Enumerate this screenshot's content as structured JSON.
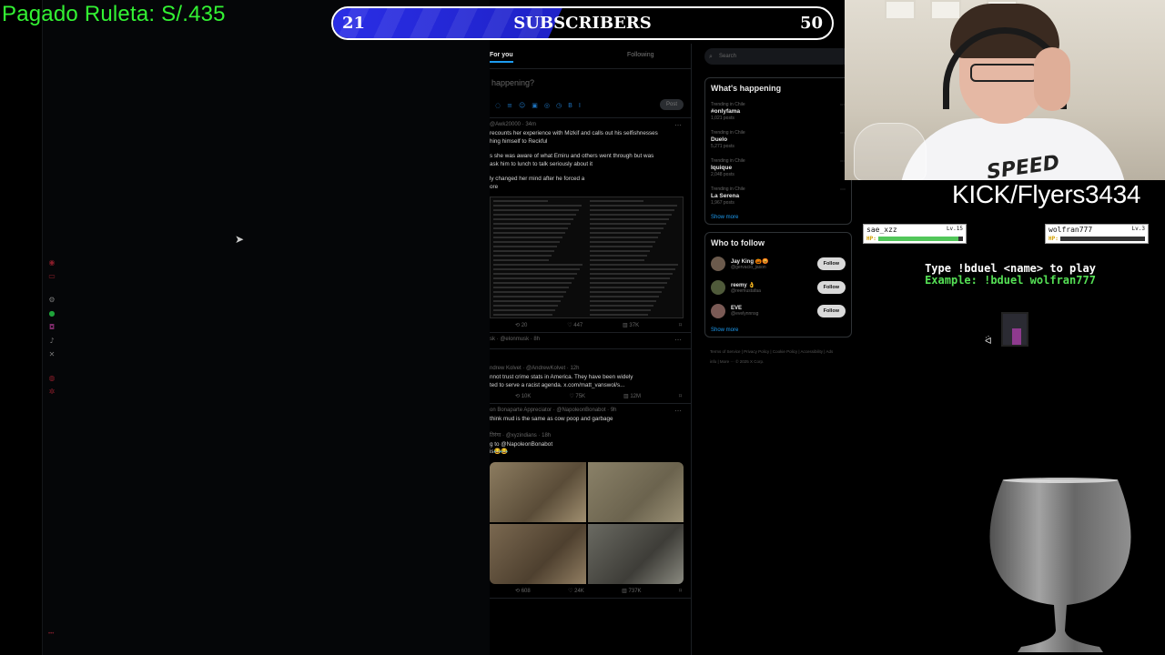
{
  "overlay": {
    "donation_text": "Pagado Ruleta: S/.435",
    "kick_handle": "KICK/Flyers3434"
  },
  "subscriber_goal": {
    "current": "21",
    "label": "SUBSCRIBERS",
    "goal": "50",
    "progress_fraction": 0.42,
    "fill_color": "#2a2ee6"
  },
  "feed": {
    "tabs": [
      {
        "label": "For you",
        "active": true
      },
      {
        "label": "Following",
        "active": false
      }
    ],
    "compose_placeholder": "happening?",
    "post_label": "Post",
    "tweets": [
      {
        "author": "@Awk20000 · 34m",
        "lines": [
          "recounts her experience with Mizkif and calls out his selfishnesses",
          "hing himself to Reckful",
          "",
          "s she was aware of what Emiru and others went through but was",
          "ask him to lunch to talk seriously about it",
          "",
          "ly changed her mind after he forced a",
          "ore"
        ],
        "stats": [
          "20",
          "447",
          "37K"
        ],
        "has_screenshot": true
      },
      {
        "author": "sk · @elonmusk · 8h",
        "lines": [],
        "stats": [],
        "has_screenshot": false
      },
      {
        "author": "ndrew Kolvet · @AndrewKolvet · 12h",
        "lines": [
          "nnot trust crime stats in America. They have been widely",
          "ted to serve a racist agenda. x.com/matt_vanswol/s..."
        ],
        "stats": [
          "10K",
          "75K",
          "12M"
        ],
        "has_screenshot": false
      },
      {
        "author": "on Bonaparte Appreciator · @NapoleonBonabot · 9h",
        "lines": [
          "think mud is the same as cow poop and garbage"
        ],
        "stats": [],
        "has_screenshot": false
      },
      {
        "author": "तिरंगा · @xyzindians · 18h",
        "lines": [
          "g to @NapoleonBonabot",
          "is😂😂"
        ],
        "stats": [
          "608",
          "24K",
          "737K"
        ],
        "has_photos": true
      }
    ]
  },
  "sidebar": {
    "search_placeholder": "Search",
    "happening_title": "What's happening",
    "trends": [
      {
        "context": "Trending in Chile",
        "name": "#onlyfama",
        "count": "1,021 posts"
      },
      {
        "context": "Trending in Chile",
        "name": "Duelo",
        "count": "5,271 posts"
      },
      {
        "context": "Trending in Chile",
        "name": "Iquique",
        "count": "2,048 posts"
      },
      {
        "context": "Trending in Chile",
        "name": "La Serena",
        "count": "1,967 posts"
      }
    ],
    "show_more": "Show more",
    "follow_title": "Who to follow",
    "follow": [
      {
        "name": "Jay King 🎃😡",
        "handle": "@gervacio_jason",
        "button": "Follow"
      },
      {
        "name": "reemy 👌",
        "handle": "@reemustafaa",
        "button": "Follow"
      },
      {
        "name": "EVE",
        "handle": "@evelynnnsg",
        "button": "Follow"
      }
    ],
    "footer": "Terms of Service | Privacy Policy | Cookie Policy | Accessibility | Ads info | More ··· © 2025 X Corp."
  },
  "duel_game": {
    "player1": {
      "name": "sae_xzz",
      "level": "Lv.15",
      "hp_label": "HP:",
      "hp_fraction": 0.95
    },
    "player2": {
      "name": "wolfran777",
      "level": "Lv.3",
      "hp_label": "HP:",
      "hp_fraction": 0.0
    },
    "instruction": "Type !bduel <name> to play",
    "example": "Example: !bduel wolfran777"
  }
}
